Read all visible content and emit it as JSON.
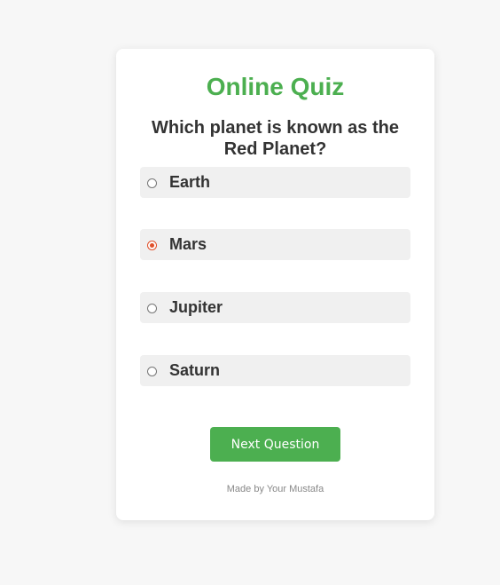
{
  "quiz": {
    "title": "Online Quiz",
    "question": "Which planet is known as the Red Planet?",
    "options": [
      {
        "label": "Earth",
        "selected": false
      },
      {
        "label": "Mars",
        "selected": true
      },
      {
        "label": "Jupiter",
        "selected": false
      },
      {
        "label": "Saturn",
        "selected": false
      }
    ],
    "next_label": "Next Question",
    "footer": "Made by Your Mustafa"
  },
  "colors": {
    "accent": "#4caf50",
    "radio_selected": "#e0502a",
    "option_bg": "#f0f0f0",
    "page_bg": "#f7f7f7"
  }
}
